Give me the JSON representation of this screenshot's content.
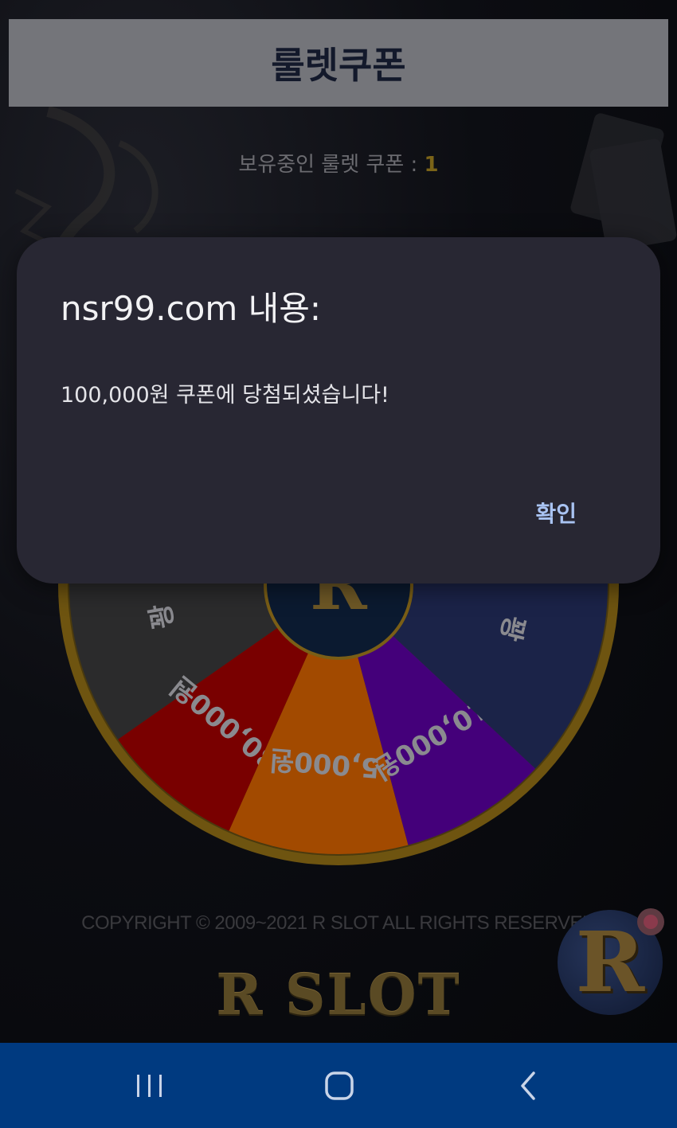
{
  "header": {
    "title": "룰렛쿠폰"
  },
  "coupon_status": {
    "label": "보유중인 룰렛 쿠폰 : ",
    "count": "1"
  },
  "wheel": {
    "segments": [
      {
        "label": "꽝",
        "color": "#2b2b2c"
      },
      {
        "label": "30,000원",
        "color": "#790000"
      },
      {
        "label": "5,000원",
        "color": "#a24a00"
      },
      {
        "label": "10,000원",
        "color": "#44007a"
      },
      {
        "label": "꽝",
        "color": "#1b2348"
      }
    ],
    "center_icon": "r-logo-icon",
    "rim_color": "#8a6a14"
  },
  "footer": {
    "copyright": "COPYRIGHT © 2009~2021 R SLOT ALL RIGHTS RESERVED",
    "logo_text": "R SLOT"
  },
  "floating_button": {
    "letter": "R",
    "icon": "r-logo-icon"
  },
  "dialog": {
    "title": "nsr99.com 내용:",
    "message": "100,000원 쿠폰에 당첨되셨습니다!",
    "ok_label": "확인"
  },
  "nav_bar": {
    "items": [
      {
        "icon": "recent-apps-icon"
      },
      {
        "icon": "home-icon"
      },
      {
        "icon": "back-icon"
      }
    ],
    "color": "#003a80"
  }
}
